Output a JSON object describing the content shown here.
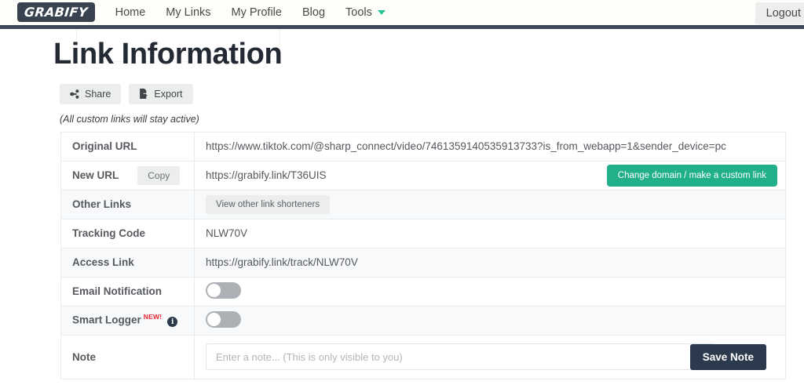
{
  "navbar": {
    "brand": "GRABIFY",
    "links": [
      {
        "label": "Home",
        "name": "nav-link-home"
      },
      {
        "label": "My Links",
        "name": "nav-link-my-links"
      },
      {
        "label": "My Profile",
        "name": "nav-link-my-profile"
      },
      {
        "label": "Blog",
        "name": "nav-link-blog"
      },
      {
        "label": "Tools",
        "name": "nav-link-tools"
      }
    ],
    "logout_label": "Logout",
    "accent_color": "#27c396",
    "bar_color": "#3b4859"
  },
  "header": {
    "title": "Link Information",
    "share_label": "Share",
    "export_label": "Export",
    "disclaimer": "(All custom links will stay active)"
  },
  "table": {
    "rows": {
      "original_url": {
        "label": "Original URL",
        "value": "https://www.tiktok.com/@sharp_connect/video/7461359140535913733?is_from_webapp=1&sender_device=pc"
      },
      "new_url": {
        "label": "New URL",
        "copy_label": "Copy",
        "value": "https://grabify.link/T36UIS",
        "change_domain_label": "Change domain / make a custom link"
      },
      "other_links": {
        "label": "Other Links",
        "button_label": "View other link shorteners"
      },
      "tracking_code": {
        "label": "Tracking Code",
        "value": "NLW70V"
      },
      "access_link": {
        "label": "Access Link",
        "value": "https://grabify.link/track/NLW70V"
      },
      "email_notification": {
        "label": "Email Notification",
        "toggle_state": "off"
      },
      "smart_logger": {
        "label": "Smart Logger",
        "badge": "NEW!",
        "info_glyph": "i",
        "toggle_state": "off"
      },
      "note": {
        "label": "Note",
        "placeholder": "Enter a note... (This is only visible to you)",
        "value": "",
        "save_label": "Save Note"
      }
    }
  },
  "colors": {
    "green_button": "#22b08a",
    "dark_button": "#2b3a4d",
    "new_badge": "#e8262f",
    "row_alt": "#f8f9fa"
  }
}
